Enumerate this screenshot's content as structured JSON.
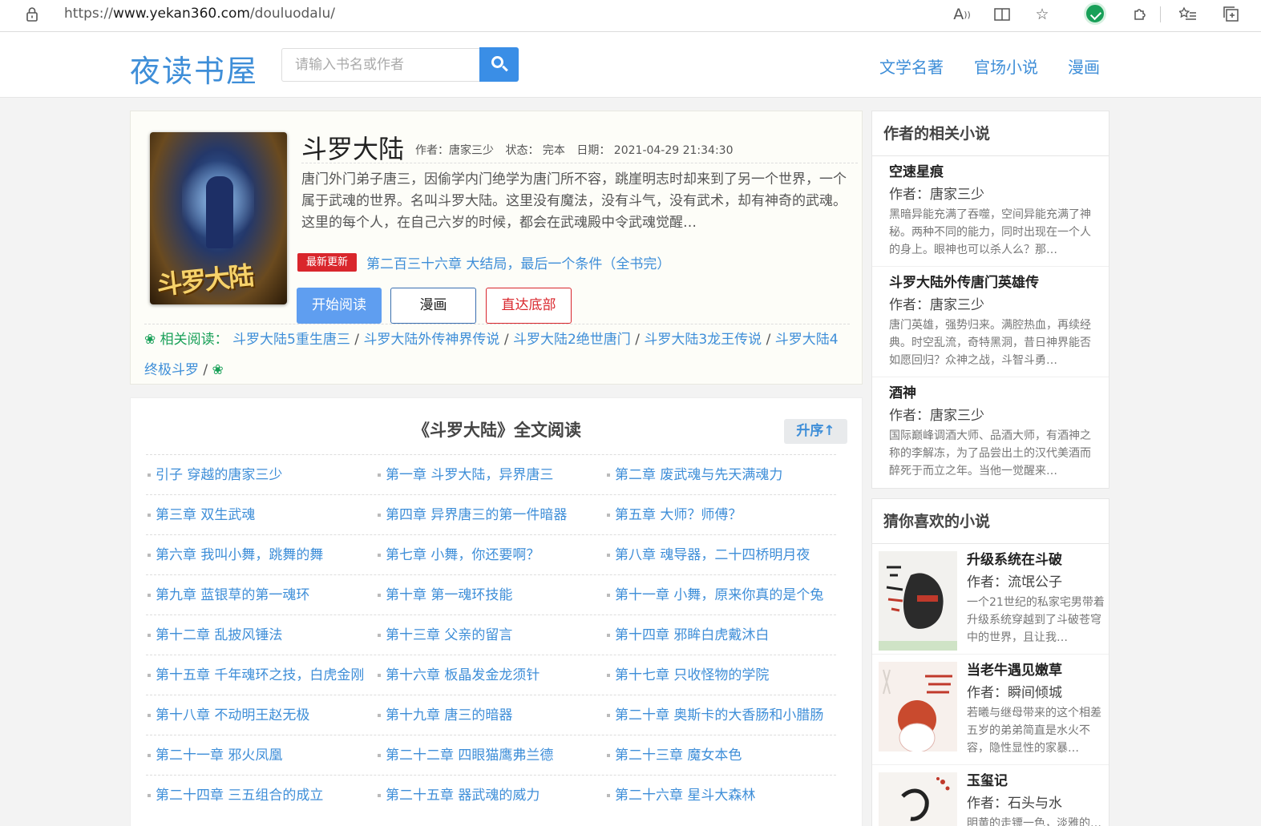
{
  "browser": {
    "url_prefix": "https://",
    "url_domain": "www.yekan360.com",
    "url_path": "/douluodalu/"
  },
  "header": {
    "logo": "夜读书屋",
    "search_placeholder": "请输入书名或作者",
    "nav": [
      "文学名著",
      "官场小说",
      "漫画"
    ]
  },
  "book": {
    "title": "斗罗大陆",
    "author_label": "作者：唐家三少",
    "status_label": "状态： 完本",
    "date_label": "日期： 2021-04-29 21:34:30",
    "cover_text": "斗罗大陆",
    "intro": "唐门外门弟子唐三，因偷学内门绝学为唐门所不容，跳崖明志时却来到了另一个世界，一个属于武魂的世界。名叫斗罗大陆。这里没有魔法，没有斗气，没有武术，却有神奇的武魂。这里的每个人，在自己六岁的时候，都会在武魂殿中令武魂觉醒…",
    "latest_badge": "最新更新",
    "latest_chapter": "第二百三十六章 大结局，最后一个条件（全书完）",
    "buttons": {
      "read": "开始阅读",
      "comic": "漫画",
      "bottom": "直达底部"
    },
    "related_lead": "❀ 相关阅读：",
    "related_links": [
      "斗罗大陆5重生唐三",
      "斗罗大陆外传神界传说",
      "斗罗大陆2绝世唐门",
      "斗罗大陆3龙王传说",
      "斗罗大陆4终极斗罗"
    ],
    "related_sep": " / ",
    "related_tail": "❀"
  },
  "chapters": {
    "title": "《斗罗大陆》全文阅读",
    "sort_label": "升序↑",
    "rows": [
      [
        "引子 穿越的唐家三少",
        "第一章 斗罗大陆，异界唐三",
        "第二章 废武魂与先天满魂力"
      ],
      [
        "第三章 双生武魂",
        "第四章 异界唐三的第一件暗器",
        "第五章 大师？师傅？"
      ],
      [
        "第六章 我叫小舞，跳舞的舞",
        "第七章 小舞，你还要啊？",
        "第八章 魂导器，二十四桥明月夜"
      ],
      [
        "第九章 蓝银草的第一魂环",
        "第十章 第一魂环技能",
        "第十一章 小舞，原来你真的是个兔"
      ],
      [
        "第十二章 乱披风锤法",
        "第十三章 父亲的留言",
        "第十四章 邪眸白虎戴沐白"
      ],
      [
        "第十五章 千年魂环之技，白虎金刚",
        "第十六章 板晶发金龙须针",
        "第十七章 只收怪物的学院"
      ],
      [
        "第十八章 不动明王赵无极",
        "第十九章 唐三的暗器",
        "第二十章 奥斯卡的大香肠和小腊肠"
      ],
      [
        "第二十一章 邪火凤凰",
        "第二十二章 四眼猫鹰弗兰德",
        "第二十三章 魔女本色"
      ],
      [
        "第二十四章 三五组合的成立",
        "第二十五章 器武魂的威力",
        "第二十六章 星斗大森林"
      ]
    ]
  },
  "sidebar": {
    "author_head": "作者的相关小说",
    "author_items": [
      {
        "title": "空速星痕",
        "author": "作者：唐家三少",
        "desc": "黑暗异能充满了吞噬，空间异能充满了神秘。两种不同的能力，同时出现在一个人的身上。眼神也可以杀人么？那…"
      },
      {
        "title": "斗罗大陆外传唐门英雄传",
        "author": "作者：唐家三少",
        "desc": "唐门英雄，强势归来。满腔热血，再续经典。时空乱流，奇特黑洞，昔日神界能否如愿回归？众神之战，斗智斗勇…"
      },
      {
        "title": "酒神",
        "author": "作者：唐家三少",
        "desc": "国际巅峰调酒大师、品酒大师，有酒神之称的李解冻，为了品尝出土的汉代美酒而醉死于而立之年。当他一觉醒来…"
      }
    ],
    "guess_head": "猜你喜欢的小说",
    "guess_items": [
      {
        "title": "升级系统在斗破",
        "author": "作者：流氓公子",
        "desc": "一个21世纪的私家宅男带着升级系统穿越到了斗破苍穹中的世界，且让我…"
      },
      {
        "title": "当老牛遇见嫩草",
        "author": "作者：瞬间倾城",
        "desc": "若曦与继母带来的这个相差五岁的弟弟简直是水火不容，隐性显性的家暴…"
      },
      {
        "title": "玉玺记",
        "author": "作者：石头与水",
        "desc": "明黄的走镖一色，淡雅的…"
      }
    ]
  }
}
